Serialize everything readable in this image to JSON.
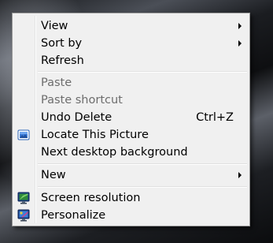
{
  "context_menu": {
    "items": [
      {
        "label": "View",
        "has_submenu": true
      },
      {
        "label": "Sort by",
        "has_submenu": true
      },
      {
        "label": "Refresh"
      },
      {
        "label": "Paste",
        "disabled": true
      },
      {
        "label": "Paste shortcut",
        "disabled": true
      },
      {
        "label": "Undo Delete",
        "shortcut": "Ctrl+Z"
      },
      {
        "label": "Locate This Picture",
        "icon": "picture-icon"
      },
      {
        "label": "Next desktop background"
      },
      {
        "label": "New",
        "has_submenu": true
      },
      {
        "label": "Screen resolution",
        "icon": "monitor-icon"
      },
      {
        "label": "Personalize",
        "icon": "personalize-icon"
      }
    ]
  },
  "colors": {
    "menu_bg": "#f0f0f0",
    "menu_border": "#979797",
    "disabled_text": "#6d6d6d"
  }
}
